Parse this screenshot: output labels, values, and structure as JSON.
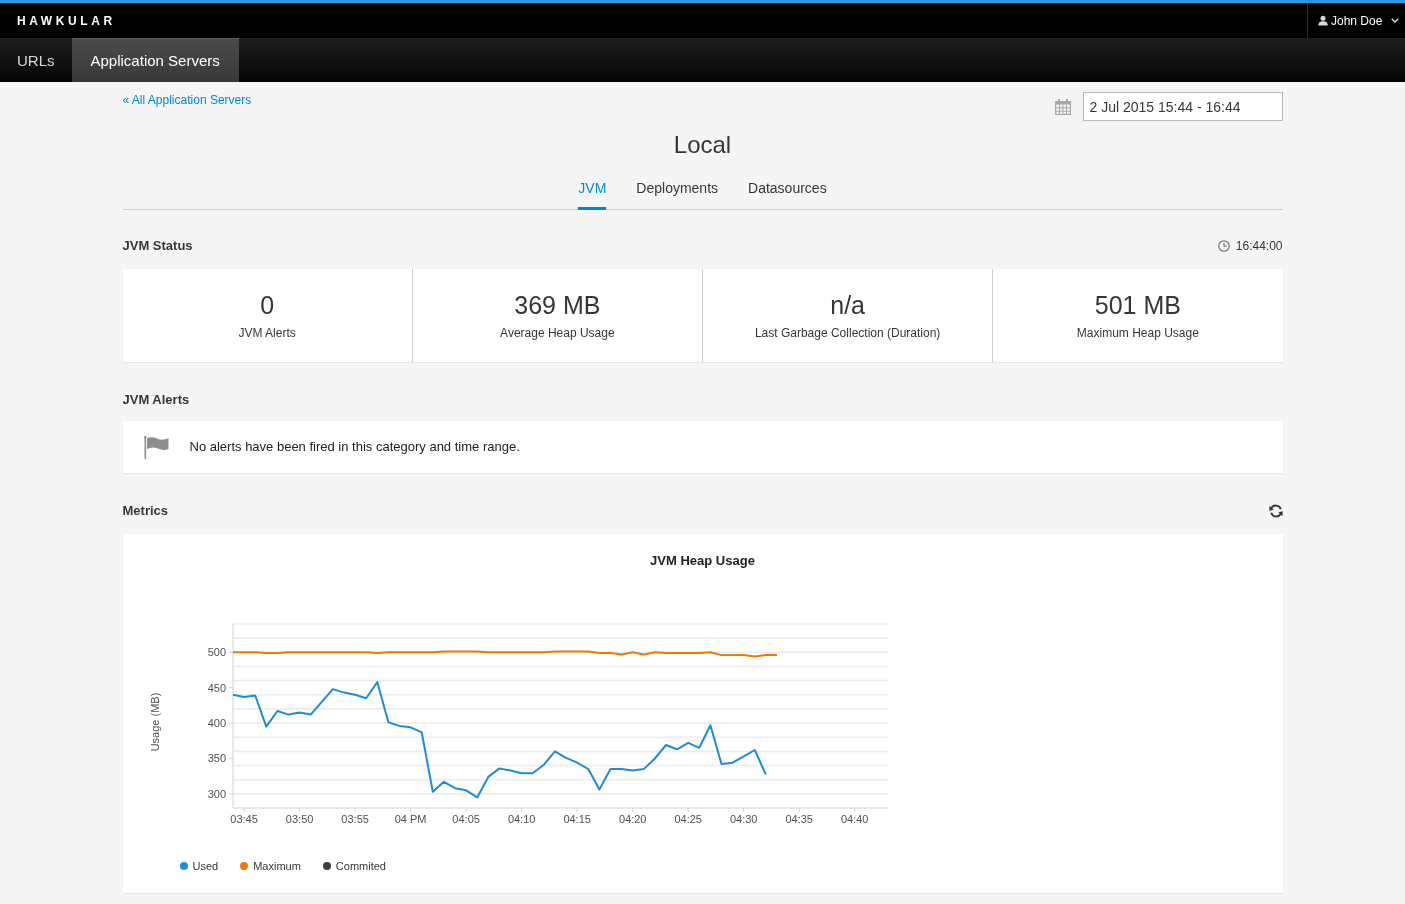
{
  "header": {
    "brand": "HAWKULAR",
    "user": {
      "name": "John Doe"
    }
  },
  "nav": [
    {
      "label": "URLs",
      "selected": false
    },
    {
      "label": "Application Servers",
      "selected": true
    }
  ],
  "back_link": "« All Application Servers",
  "time_range": {
    "value": "2 Jul 2015 15:44 - 16:44"
  },
  "title": "Local",
  "tabs": [
    {
      "label": "JVM",
      "selected": true
    },
    {
      "label": "Deployments",
      "selected": false
    },
    {
      "label": "Datasources",
      "selected": false
    }
  ],
  "jvm_status": {
    "heading": "JVM Status",
    "timestamp": "16:44:00",
    "cards": [
      {
        "value": "0",
        "label": "JVM Alerts"
      },
      {
        "value": "369 MB",
        "label": "Average Heap Usage"
      },
      {
        "value": "n/a",
        "label": "Last Garbage Collection (Duration)"
      },
      {
        "value": "501 MB",
        "label": "Maximum Heap Usage"
      }
    ]
  },
  "jvm_alerts": {
    "heading": "JVM Alerts",
    "message": "No alerts have been fired in this category and time range."
  },
  "metrics": {
    "heading": "Metrics",
    "chart_data": {
      "type": "line",
      "title": "JVM Heap Usage",
      "ylabel": "Usage (MB)",
      "grid": true,
      "legend": "bottom",
      "categories": [
        null,
        "03:45",
        null,
        null,
        null,
        null,
        "03:50",
        null,
        null,
        null,
        null,
        "03:55",
        null,
        null,
        null,
        null,
        "04 PM",
        null,
        null,
        null,
        null,
        "04:05",
        null,
        null,
        null,
        null,
        "04:10",
        null,
        null,
        null,
        null,
        "04:15",
        null,
        null,
        null,
        null,
        "04:20",
        null,
        null,
        null,
        null,
        "04:25",
        null,
        null,
        null,
        null,
        "04:30",
        null,
        null,
        null,
        null,
        "04:35",
        null,
        null,
        null,
        null,
        "04:40",
        null,
        null,
        null
      ],
      "series": [
        {
          "name": "Used",
          "color": "#1f8dd6",
          "values": [
            440,
            437,
            439,
            395,
            417,
            412,
            415,
            412,
            430,
            448,
            443,
            440,
            435,
            458,
            401,
            396,
            394,
            387,
            303,
            317,
            308,
            305,
            295,
            324,
            336,
            333,
            329,
            329,
            341,
            360,
            351,
            344,
            335,
            306,
            335,
            335,
            333,
            335,
            350,
            369,
            363,
            372,
            365,
            397,
            342,
            344,
            353,
            362,
            327,
            null,
            null,
            null,
            null,
            null,
            null,
            null,
            null,
            null,
            null,
            null
          ]
        },
        {
          "name": "Maximum",
          "color": "#ec7a08",
          "values": [
            500,
            500,
            500,
            499,
            499,
            500,
            500,
            500,
            500,
            500,
            500,
            500,
            500,
            499,
            500,
            500,
            500,
            500,
            500,
            501,
            501,
            501,
            501,
            500,
            500,
            500,
            500,
            500,
            500,
            501,
            501,
            501,
            501,
            499,
            499,
            497,
            500,
            497,
            500,
            499,
            499,
            499,
            499,
            500,
            496,
            496,
            496,
            494,
            496,
            496,
            null,
            null,
            null,
            null,
            null,
            null,
            null,
            null,
            null,
            null
          ]
        },
        {
          "name": "Commited",
          "color": "#393f44",
          "values": [
            null,
            null,
            null,
            null,
            null,
            null,
            null,
            null,
            null,
            null,
            null,
            null,
            null,
            null,
            null,
            null,
            null,
            null,
            null,
            null,
            null,
            null,
            null,
            null,
            null,
            null,
            null,
            null,
            null,
            null,
            null,
            null,
            null,
            null,
            null,
            null,
            null,
            null,
            null,
            null,
            null,
            null,
            null,
            null,
            null,
            null,
            null,
            null,
            null,
            null,
            null,
            null,
            null,
            null,
            null,
            null,
            null,
            null,
            null,
            null
          ]
        }
      ],
      "ylim": [
        280,
        540
      ],
      "yticks": [
        300,
        350,
        400,
        450,
        500
      ]
    }
  }
}
